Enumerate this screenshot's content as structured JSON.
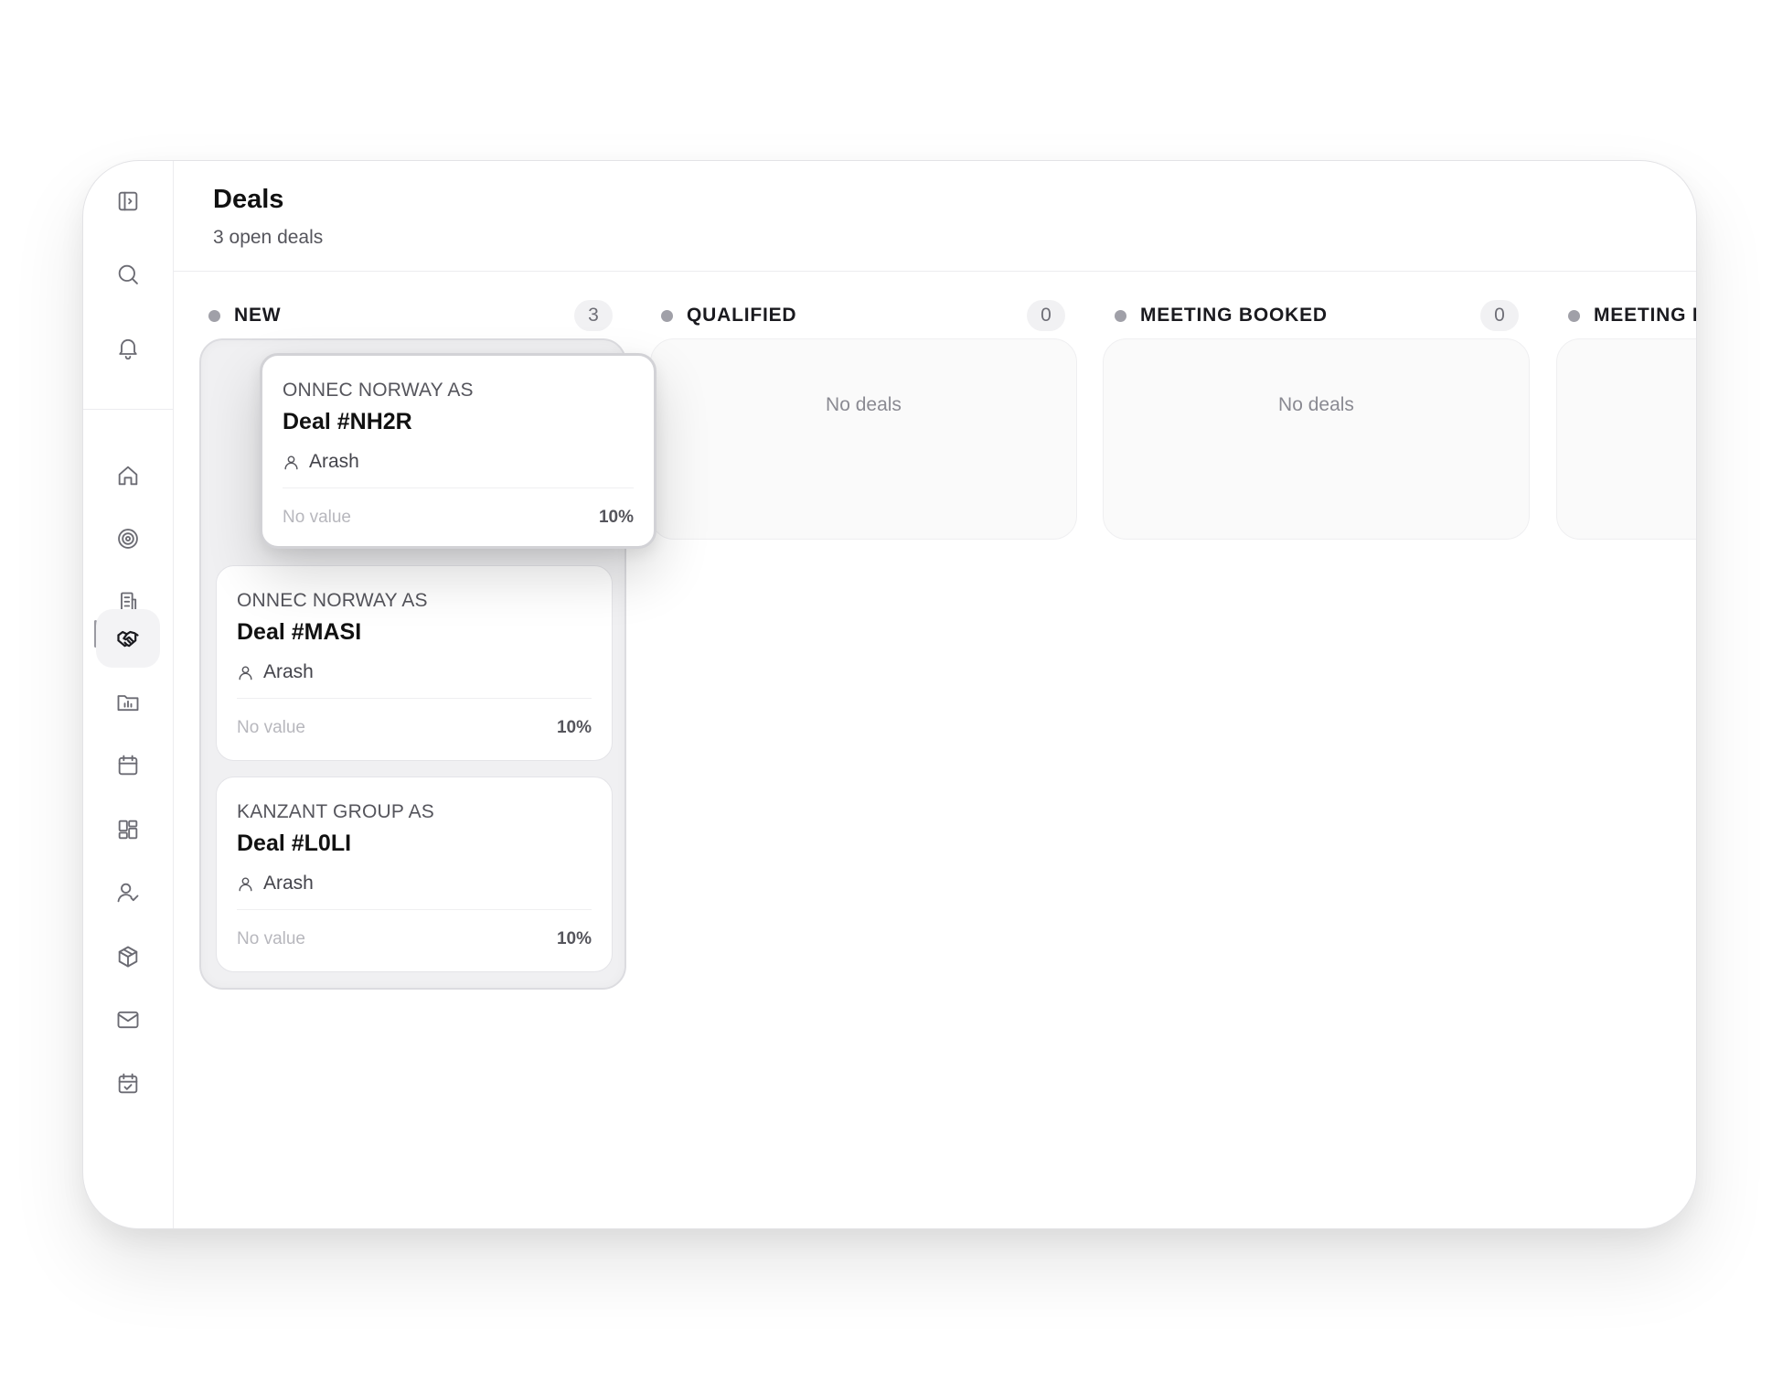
{
  "header": {
    "title": "Deals",
    "subtitle": "3 open deals"
  },
  "sidebar": {
    "items": [
      {
        "icon": "panel-toggle-icon"
      },
      {
        "icon": "search-icon"
      },
      {
        "icon": "bell-icon"
      },
      {
        "icon": "home-icon"
      },
      {
        "icon": "target-icon"
      },
      {
        "icon": "building-icon"
      },
      {
        "icon": "handshake-icon",
        "active": true
      },
      {
        "icon": "folder-chart-icon"
      },
      {
        "icon": "calendar-icon"
      },
      {
        "icon": "dashboard-icon"
      },
      {
        "icon": "user-check-icon"
      },
      {
        "icon": "box-icon"
      },
      {
        "icon": "mail-icon"
      },
      {
        "icon": "calendar-check-icon"
      }
    ]
  },
  "columns": [
    {
      "name": "NEW",
      "count": "3"
    },
    {
      "name": "QUALIFIED",
      "count": "0",
      "empty_text": "No deals"
    },
    {
      "name": "MEETING BOOKED",
      "count": "0",
      "empty_text": "No deals"
    },
    {
      "name": "MEETING D"
    }
  ],
  "deals": [
    {
      "company": "ONNEC NORWAY AS",
      "title": "Deal #NH2R",
      "owner": "Arash",
      "value": "No value",
      "probability": "10%"
    },
    {
      "company": "ONNEC NORWAY AS",
      "title": "Deal #MASI",
      "owner": "Arash",
      "value": "No value",
      "probability": "10%"
    },
    {
      "company": "KANZANT GROUP AS",
      "title": "Deal #L0LI",
      "owner": "Arash",
      "value": "No value",
      "probability": "10%"
    }
  ],
  "colors": {
    "accent_dark": "#111111",
    "muted_text": "#55555c",
    "border": "#e4e4e8",
    "status_dot": "#a0a0a8"
  }
}
